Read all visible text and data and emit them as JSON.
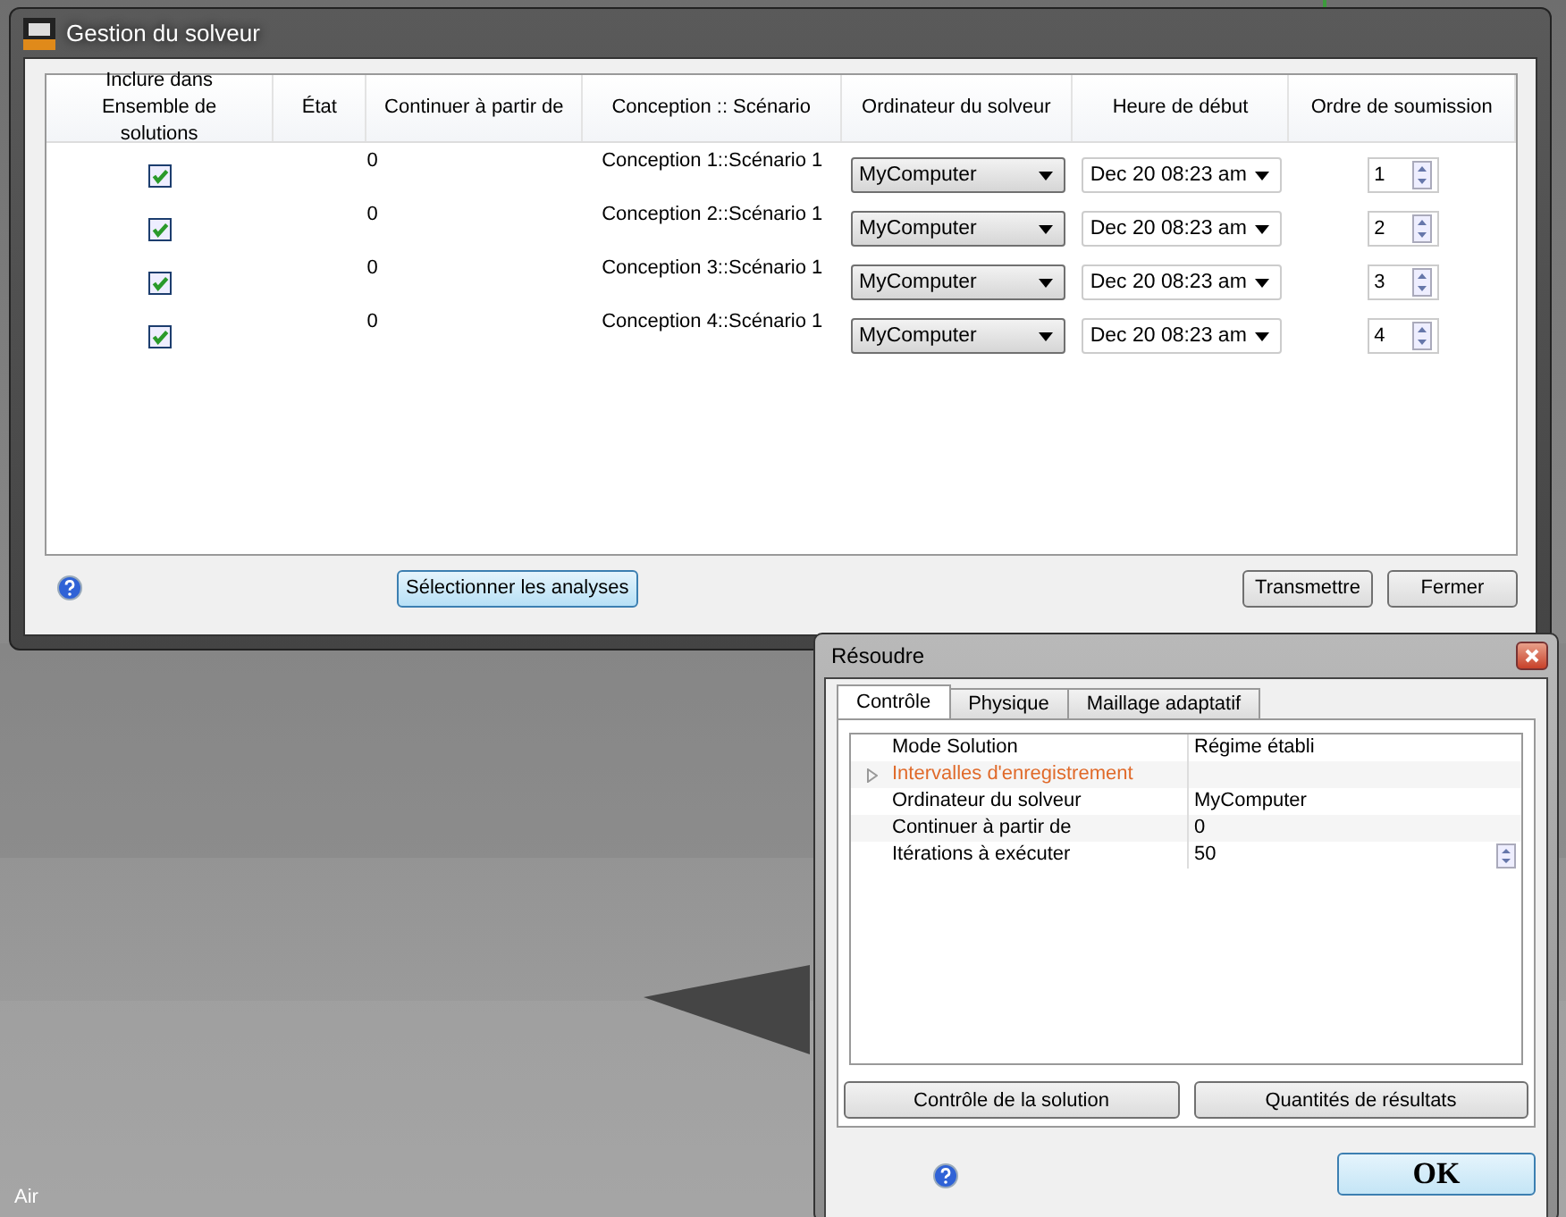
{
  "solver_window": {
    "title": "Gestion du solveur",
    "table": {
      "columns": [
        "Inclure dans Ensemble de solutions",
        "État",
        "Continuer à partir de",
        "Conception :: Scénario",
        "Ordinateur du solveur",
        "Heure de début",
        "Ordre de soumission"
      ],
      "rows": [
        {
          "included": true,
          "continue_from": "0",
          "design": "Conception 1::Scénario 1",
          "computer": "MyComputer",
          "start_time": "Dec 20 08:23 am",
          "order": "1"
        },
        {
          "included": true,
          "continue_from": "0",
          "design": "Conception 2::Scénario 1",
          "computer": "MyComputer",
          "start_time": "Dec 20 08:23 am",
          "order": "2"
        },
        {
          "included": true,
          "continue_from": "0",
          "design": "Conception 3::Scénario 1",
          "computer": "MyComputer",
          "start_time": "Dec 20 08:23 am",
          "order": "3"
        },
        {
          "included": true,
          "continue_from": "0",
          "design": "Conception 4::Scénario 1",
          "computer": "MyComputer",
          "start_time": "Dec 20 08:23 am",
          "order": "4"
        }
      ]
    },
    "select_button": "Sélectionner les analyses",
    "buttons": [
      "Transmettre",
      "Fermer"
    ]
  },
  "viewport": {
    "label": "Air"
  },
  "solve_dialog": {
    "title": "Résoudre",
    "tabs": [
      {
        "label": "Contrôle",
        "selected": true
      },
      {
        "label": "Physique",
        "selected": false
      },
      {
        "label": "Maillage adaptatif",
        "selected": false
      }
    ],
    "properties": [
      {
        "kind": "field",
        "name": "Mode Solution",
        "value": "Régime établi"
      },
      {
        "kind": "group",
        "name": "Intervalles d'enregistrement",
        "expanded": false
      },
      {
        "kind": "field",
        "name": "Ordinateur du solveur",
        "value": "MyComputer"
      },
      {
        "kind": "field",
        "name": "Continuer à partir de",
        "value": "0"
      },
      {
        "kind": "spin",
        "name": "Itérations à exécuter",
        "value": "50"
      }
    ],
    "panel_buttons": [
      "Contrôle de la solution",
      "Quantités de résultats"
    ],
    "ok_button": "OK"
  }
}
